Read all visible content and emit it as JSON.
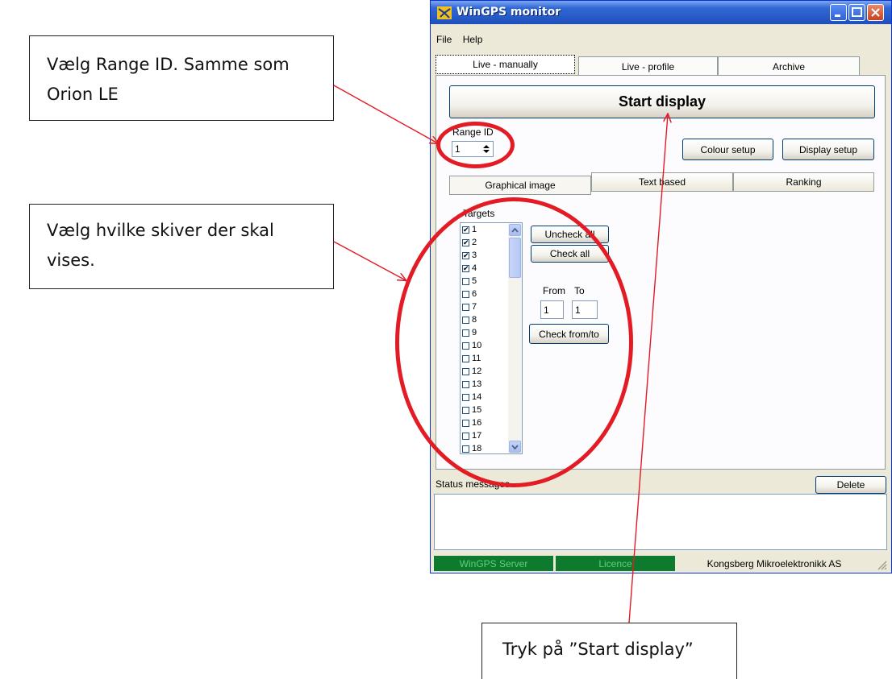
{
  "callouts": {
    "range_id": {
      "line1": "Vælg Range ID. Samme som",
      "line2": "Orion LE"
    },
    "targets": {
      "line1": "Vælg hvilke skiver der skal",
      "line2": "vises."
    },
    "start": {
      "text": "Tryk på ”Start display”"
    }
  },
  "window": {
    "title": "WinGPS monitor",
    "menu": [
      "File",
      "Help"
    ],
    "tabs": [
      "Live - manually",
      "Live - profile",
      "Archive"
    ],
    "start_button": "Start display",
    "range_id": {
      "label": "Range ID",
      "value": "1"
    },
    "colour_setup": "Colour setup",
    "display_setup": "Display setup",
    "subtabs": [
      "Graphical image",
      "Text based",
      "Ranking"
    ],
    "targets": {
      "label": "Targets",
      "items": [
        {
          "n": "1",
          "checked": true
        },
        {
          "n": "2",
          "checked": true
        },
        {
          "n": "3",
          "checked": true
        },
        {
          "n": "4",
          "checked": true
        },
        {
          "n": "5",
          "checked": false
        },
        {
          "n": "6",
          "checked": false
        },
        {
          "n": "7",
          "checked": false
        },
        {
          "n": "8",
          "checked": false
        },
        {
          "n": "9",
          "checked": false
        },
        {
          "n": "10",
          "checked": false
        },
        {
          "n": "11",
          "checked": false
        },
        {
          "n": "12",
          "checked": false
        },
        {
          "n": "13",
          "checked": false
        },
        {
          "n": "14",
          "checked": false
        },
        {
          "n": "15",
          "checked": false
        },
        {
          "n": "16",
          "checked": false
        },
        {
          "n": "17",
          "checked": false
        },
        {
          "n": "18",
          "checked": false
        }
      ]
    },
    "uncheck_all": "Uncheck all",
    "check_all": "Check all",
    "from_label": "From",
    "to_label": "To",
    "from_value": "1",
    "to_value": "1",
    "check_from_to": "Check from/to",
    "status_label": "Status messages",
    "delete_button": "Delete",
    "status_bar": {
      "server": "WinGPS Server",
      "licence": "Licence",
      "company": "Kongsberg Mikroelektronikk AS"
    }
  },
  "colors": {
    "annotation": "#e21b24",
    "status_green": "#0e7a2e",
    "status_green_text": "#5fd07a"
  }
}
